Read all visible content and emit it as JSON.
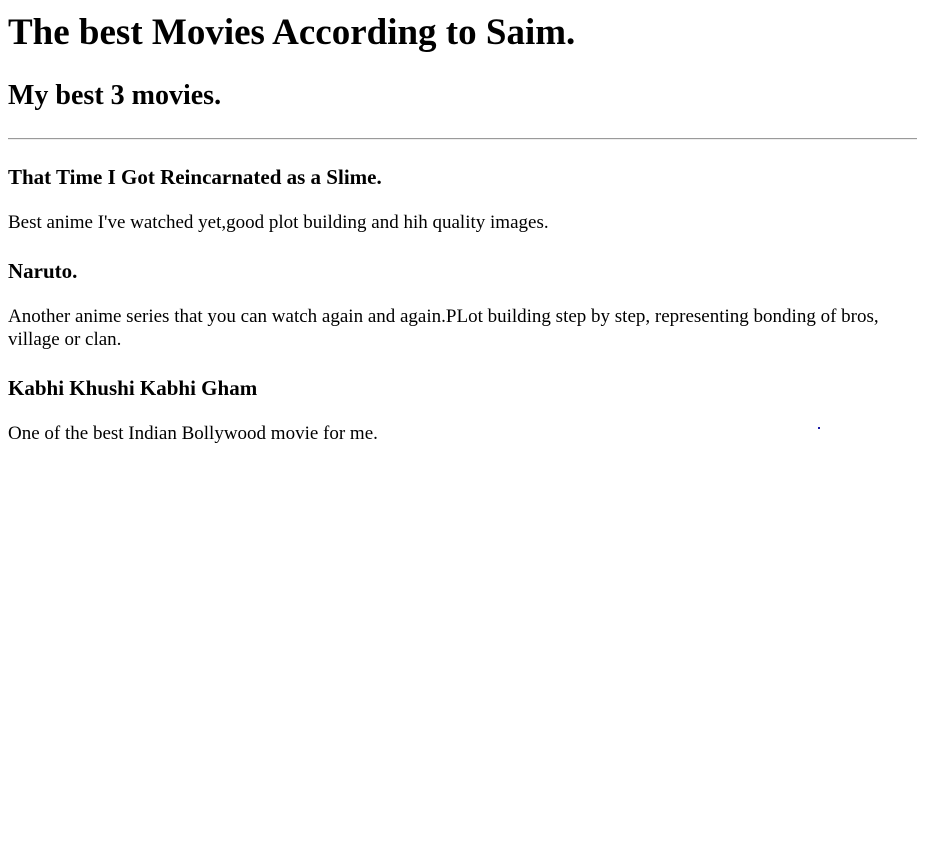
{
  "page": {
    "title": "The best Movies According to Saim.",
    "subtitle": "My best 3 movies."
  },
  "movies": [
    {
      "title": "That Time I Got Reincarnated as a Slime.",
      "description": "Best anime I've watched yet,good plot building and hih quality images."
    },
    {
      "title": "Naruto.",
      "description": "Another anime series that you can watch again and again.PLot building step by step, representing bonding of bros, village or clan."
    },
    {
      "title": "Kabhi Khushi Kabhi Gham",
      "description": "One of the best Indian Bollywood movie for me."
    }
  ]
}
